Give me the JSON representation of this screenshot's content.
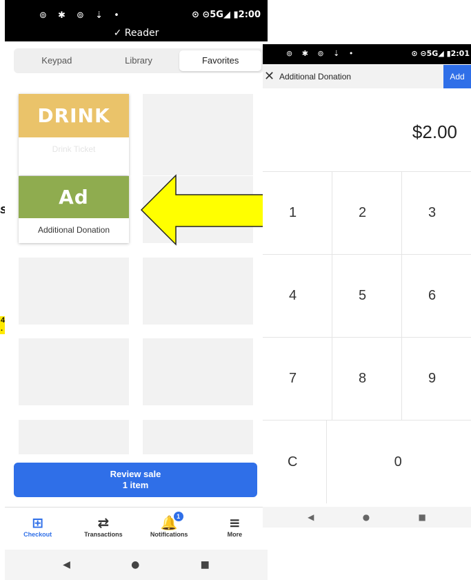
{
  "left_phone": {
    "status": {
      "left_icons": "⊚ ✱ ⊚ ⇣ •",
      "right": "⊙ ⊝5G◢ ▮2:00"
    },
    "reader_label": "✓ Reader",
    "tabs": [
      {
        "label": "Keypad",
        "active": false
      },
      {
        "label": "Library",
        "active": false
      },
      {
        "label": "Favorites",
        "active": true
      }
    ],
    "tiles": [
      {
        "banner": "DRINK",
        "name": "Drink Ticket",
        "color": "#eac36a"
      },
      {
        "banner": "Ad",
        "name": "Additional Donation",
        "color": "#8fac4f"
      }
    ],
    "review_button": {
      "line1": "Review sale",
      "line2": "1 item"
    },
    "bottom_nav": [
      {
        "label": "Checkout",
        "icon": "⊞",
        "active": true
      },
      {
        "label": "Transactions",
        "icon": "⇄",
        "active": false
      },
      {
        "label": "Notifications",
        "icon": "🔔",
        "badge": "1",
        "active": false
      },
      {
        "label": "More",
        "icon": "≡",
        "active": false
      }
    ],
    "sys_nav": {
      "back": "◀",
      "home": "●",
      "recent": "■"
    }
  },
  "fragments": {
    "italic_s": "s",
    "highlight_text": "4 ."
  },
  "right_phone": {
    "status": {
      "left_icons": "⊚ ✱ ⊚ ⇣ •",
      "right": "⊙ ⊝5G◢ ▮2:01"
    },
    "header": {
      "close": "✕",
      "title": "Additional Donation",
      "add_label": "Add"
    },
    "amount": "$2.00",
    "keys": [
      [
        "1",
        "2",
        "3"
      ],
      [
        "4",
        "5",
        "6"
      ],
      [
        "7",
        "8",
        "9"
      ]
    ],
    "clear_key": "C",
    "zero_key": "0",
    "sys_nav": {
      "back": "◀",
      "home": "●",
      "recent": "■"
    }
  },
  "colors": {
    "accent": "#2f6fe8",
    "arrow": "#ffff00"
  }
}
